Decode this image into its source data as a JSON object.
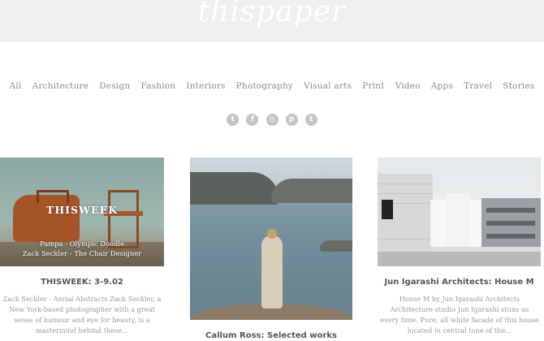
{
  "site": {
    "logo": "thispaper"
  },
  "nav": [
    "All",
    "Architecture",
    "Design",
    "Fashion",
    "Interiors",
    "Photography",
    "Visual arts",
    "Print",
    "Video",
    "Apps",
    "Travel",
    "Stories"
  ],
  "social": [
    {
      "name": "twitter-icon",
      "glyph": "t"
    },
    {
      "name": "facebook-icon",
      "glyph": "f"
    },
    {
      "name": "instagram-icon",
      "glyph": "◎"
    },
    {
      "name": "pinterest-icon",
      "glyph": "p"
    },
    {
      "name": "tumblr-icon",
      "glyph": "t"
    }
  ],
  "cards": [
    {
      "overlay_title": "THISWEEK",
      "overlay_line1": "Pampa - Olympic Doodle",
      "overlay_line2": "Zack Seckler - The Chair Designer",
      "title": "THISWEEK: 3-9.02",
      "description": "Zack Seckler - Aerial Abstracts Zack Seckler, a New York-based photographer with a great sense of humour and eye for beauty, is a mastermind behind these..."
    },
    {
      "title": "Callum Ross: Selected works",
      "description": ""
    },
    {
      "title": "Jun Igarashi Architects: House M",
      "description": "House M by Jun Igarashi Architects Architecture studio Jun Igarashi stuns us every time. Pure, all white facade of this house located in central tone of the..."
    }
  ],
  "colors": {
    "header_band": "#efefef",
    "nav_text": "#8a8a8a",
    "social_icon": "#c4c4c4"
  }
}
